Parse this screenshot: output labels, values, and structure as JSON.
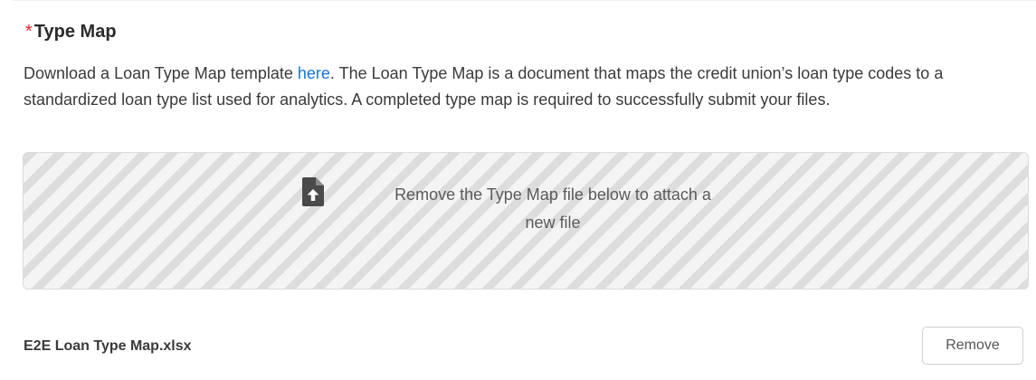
{
  "section": {
    "required_marker": "*",
    "title": "Type Map"
  },
  "description": {
    "before_link": "Download a Loan Type Map template ",
    "link_text": "here",
    "after_link": ". The Loan Type Map is a document that maps the credit union’s loan type codes to a standardized loan type list used for analytics. A completed type map is required to successfully submit your files."
  },
  "dropzone": {
    "icon": "file-upload-icon",
    "message_line1": "Remove the Type Map file below to attach a",
    "message_line2": "new file"
  },
  "attached_file": {
    "name": "E2E Loan Type Map.xlsx",
    "remove_label": "Remove"
  },
  "colors": {
    "required": "#e0252d",
    "link": "#1a73d9",
    "stripe": "#dddddd",
    "icon": "#4a4a4a"
  }
}
